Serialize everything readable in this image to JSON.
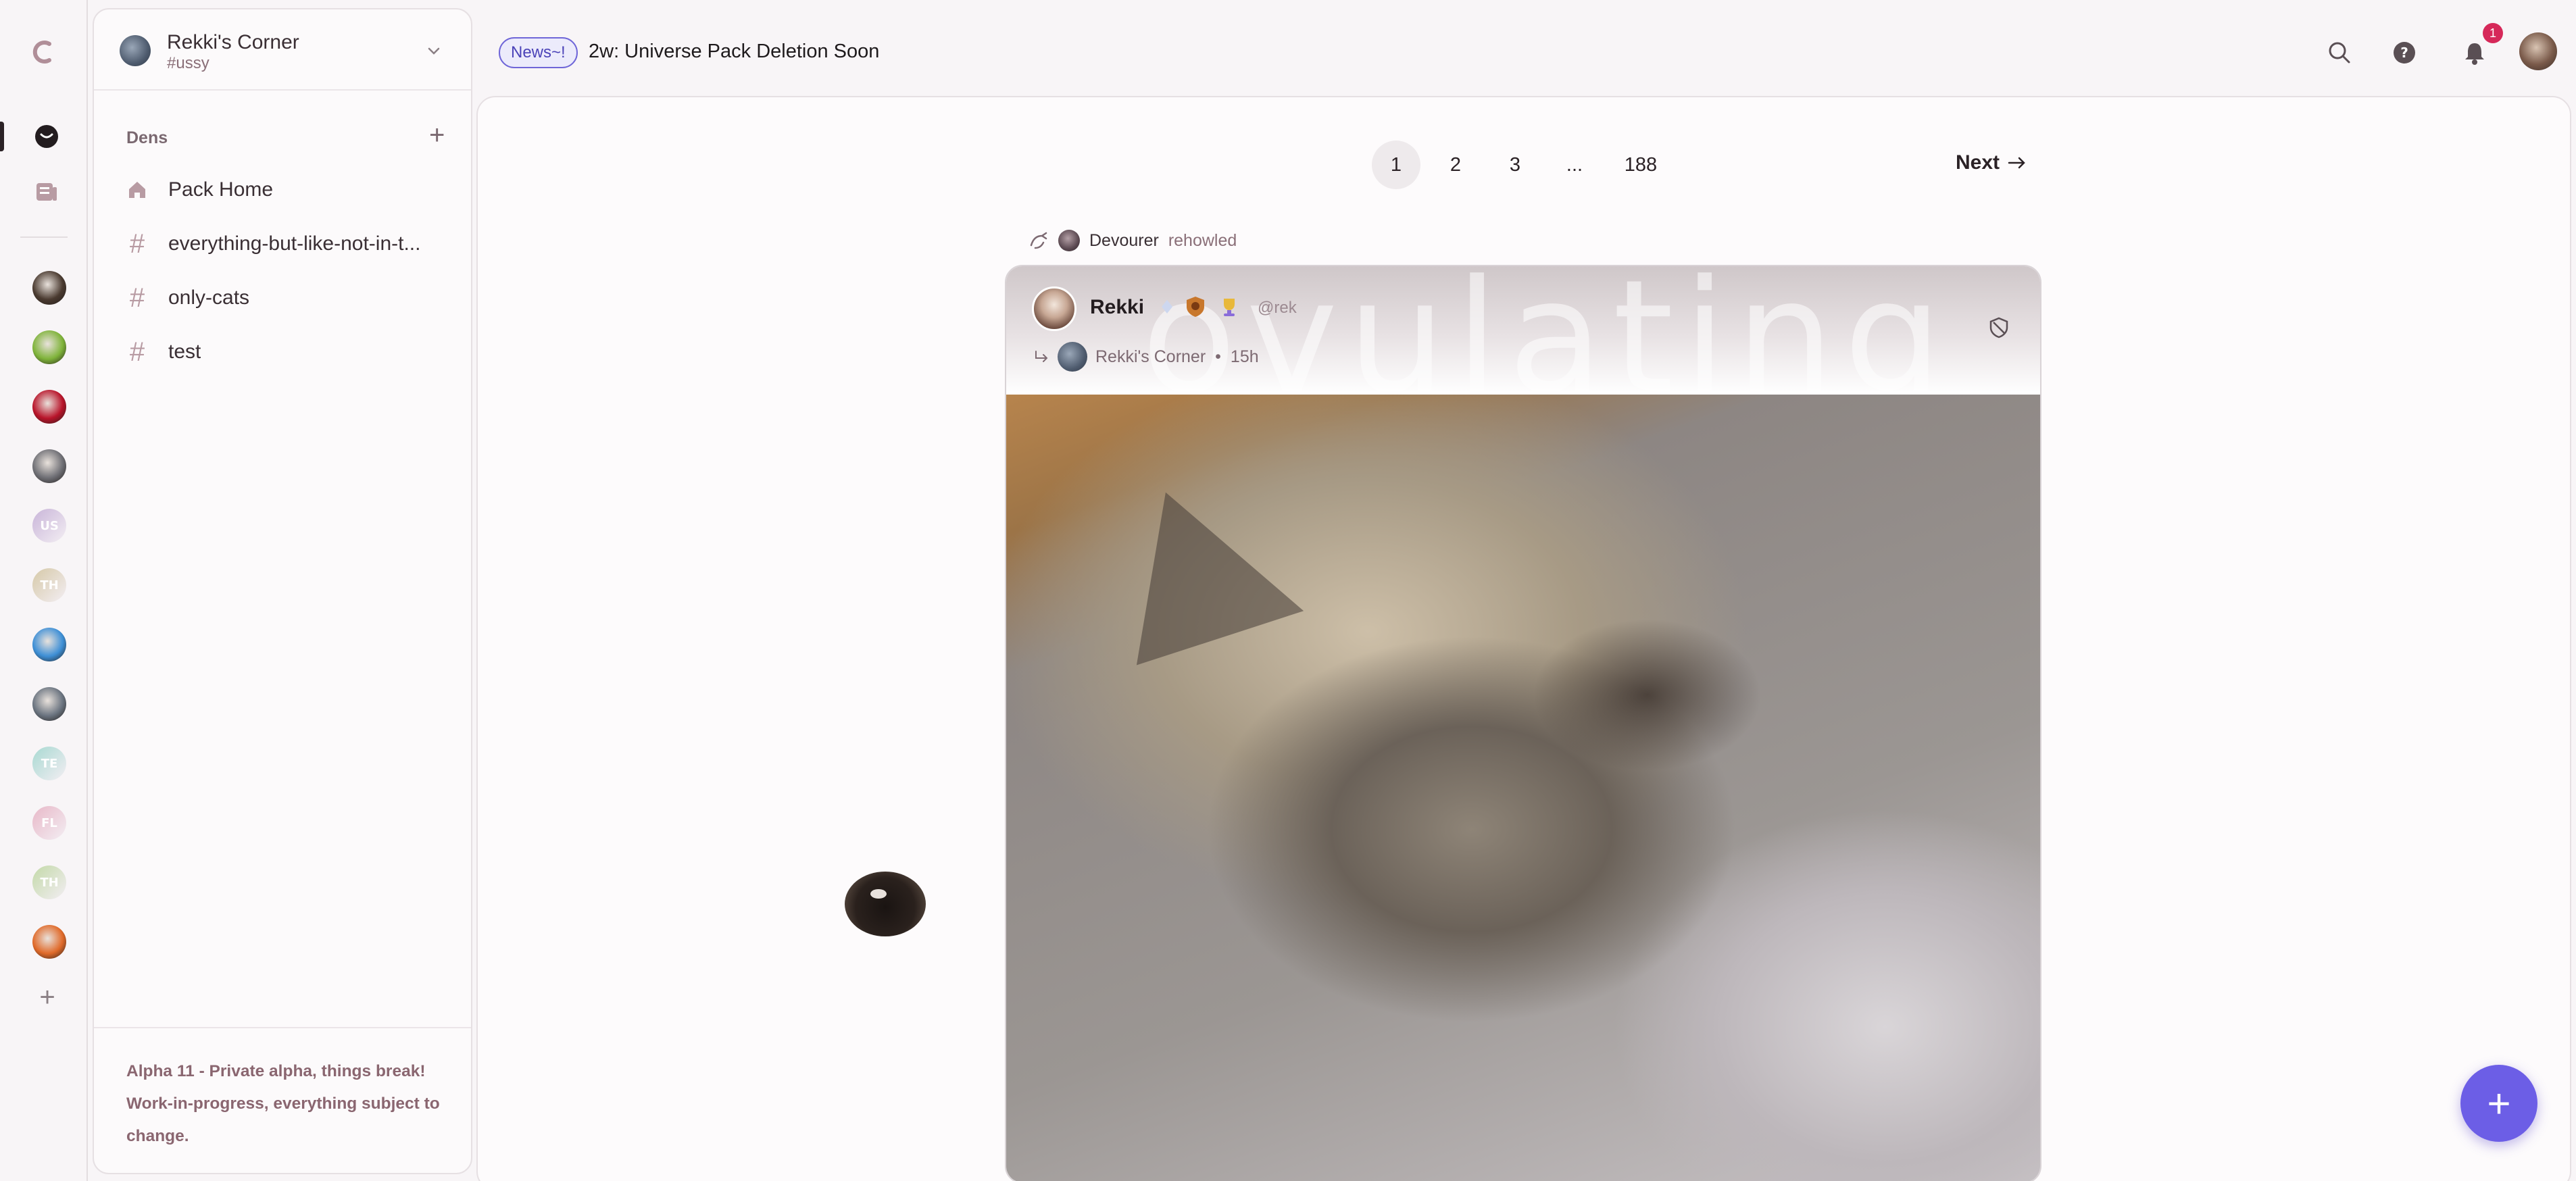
{
  "rail": {
    "servers": [
      {
        "name": "server-avatar-1",
        "kind": "image",
        "color": "#4a3a30"
      },
      {
        "name": "server-avatar-2",
        "kind": "image",
        "color": "#7fb33a"
      },
      {
        "name": "server-avatar-3",
        "kind": "image",
        "color": "#b8142a"
      },
      {
        "name": "server-avatar-4",
        "kind": "image",
        "color": "#6f6f75"
      },
      {
        "name": "server-us",
        "kind": "initials",
        "initials": "US",
        "color": "#c9b5d9"
      },
      {
        "name": "server-th-1",
        "kind": "initials",
        "initials": "TH",
        "color": "#d6c9a8"
      },
      {
        "name": "server-logo-blue",
        "kind": "image",
        "color": "#3e8fd6"
      },
      {
        "name": "server-avatar-5",
        "kind": "image",
        "color": "#6b7480"
      },
      {
        "name": "server-te",
        "kind": "initials",
        "initials": "TE",
        "color": "#a8d9d2"
      },
      {
        "name": "server-fl",
        "kind": "initials",
        "initials": "FL",
        "color": "#e8b8c8"
      },
      {
        "name": "server-th-2",
        "kind": "initials",
        "initials": "TH",
        "color": "#c3d9a8"
      },
      {
        "name": "server-avatar-6",
        "kind": "image",
        "color": "#e06a2a"
      }
    ]
  },
  "sidebar": {
    "title": "Rekki's Corner",
    "subtitle": "#ussy",
    "dens_heading": "Dens",
    "dens": [
      {
        "label": "Pack Home",
        "icon": "home-icon"
      },
      {
        "label": "everything-but-like-not-in-t...",
        "icon": "hash-icon"
      },
      {
        "label": "only-cats",
        "icon": "hash-icon"
      },
      {
        "label": "test",
        "icon": "hash-icon"
      }
    ],
    "footer": "Alpha 11 - Private alpha, things break! Work-in-progress, everything subject to change."
  },
  "topbar": {
    "news_badge": "News~!",
    "news_text": "2w: Universe Pack Deletion Soon",
    "notification_count": "1"
  },
  "pagination": {
    "pages": [
      "1",
      "2",
      "3",
      "...",
      "188"
    ],
    "active": "1",
    "next_label": "Next"
  },
  "post": {
    "rehowler": "Devourer",
    "rehowl_verb": "rehowled",
    "author": "Rekki",
    "handle": "@rek",
    "pack": "Rekki's Corner",
    "separator": "•",
    "time": "15h",
    "banner_word": "ovulating"
  },
  "colors": {
    "accent": "#6c5ee6",
    "news_border": "#6f66d8",
    "notification": "#d62859"
  }
}
